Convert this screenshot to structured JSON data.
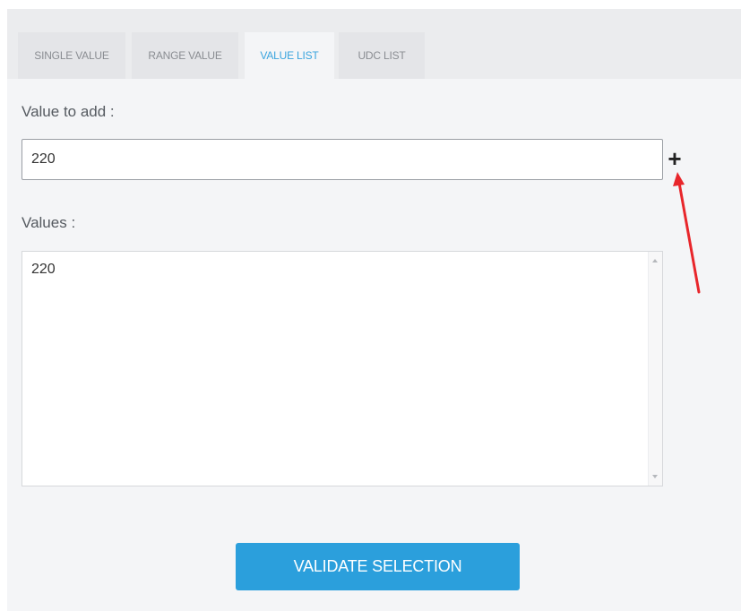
{
  "tabs": [
    {
      "label": "SINGLE VALUE",
      "active": false
    },
    {
      "label": "RANGE VALUE",
      "active": false
    },
    {
      "label": "VALUE LIST",
      "active": true
    },
    {
      "label": "UDC LIST",
      "active": false
    }
  ],
  "form": {
    "value_to_add_label": "Value to add :",
    "value_to_add_input": "220",
    "add_button_glyph": "+",
    "values_label": "Values :",
    "values_content": "220",
    "validate_button_label": "VALIDATE SELECTION"
  },
  "icons": {
    "add": "plus-icon",
    "scroll_up": "scroll-up-arrow-icon",
    "scroll_down": "scroll-down-arrow-icon"
  },
  "annotation": {
    "type": "red-arrow",
    "points_to": "add button",
    "color": "#e8262b"
  },
  "colors": {
    "accent": "#2b9fdc",
    "active_tab_text": "#3aa4de",
    "panel_background": "#f4f5f7",
    "tab_background": "#e4e5e8"
  }
}
